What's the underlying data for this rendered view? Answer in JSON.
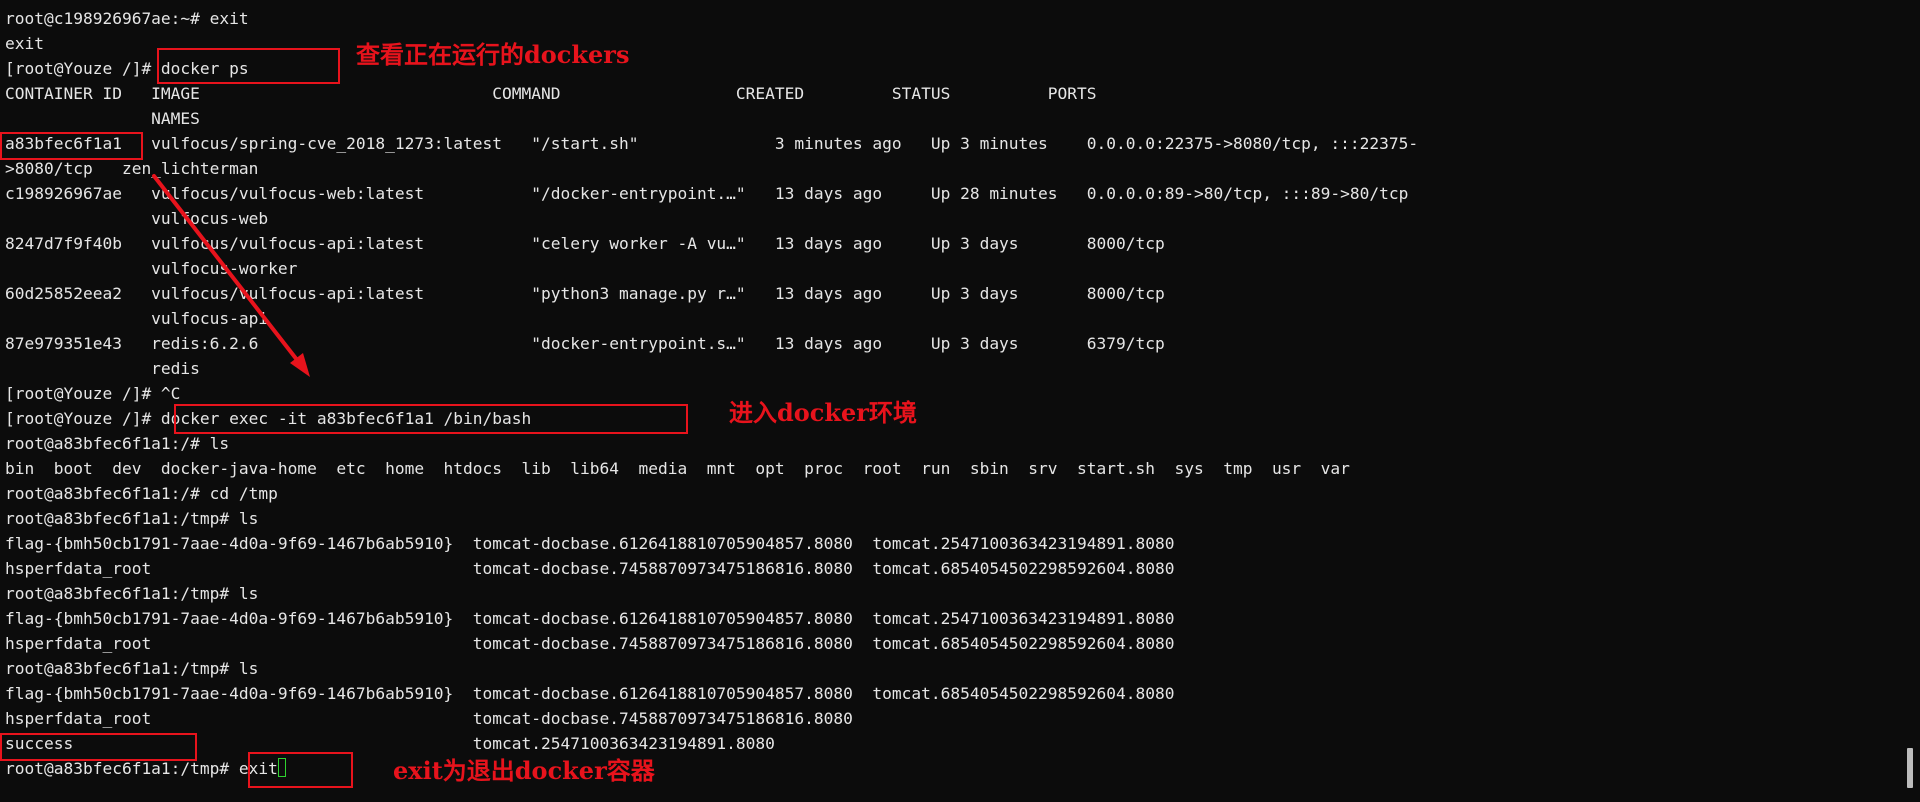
{
  "terminal": {
    "lines": [
      "root@c198926967ae:~# exit",
      "exit",
      "[root@Youze /]# docker ps",
      "CONTAINER ID   IMAGE                              COMMAND                  CREATED         STATUS          PORTS",
      "               NAMES",
      "a83bfec6f1a1   vulfocus/spring-cve_2018_1273:latest   \"/start.sh\"              3 minutes ago   Up 3 minutes    0.0.0.0:22375->8080/tcp, :::22375-",
      ">8080/tcp   zen_lichterman",
      "c198926967ae   vulfocus/vulfocus-web:latest           \"/docker-entrypoint.…\"   13 days ago     Up 28 minutes   0.0.0.0:89->80/tcp, :::89->80/tcp",
      "               vulfocus-web",
      "8247d7f9f40b   vulfocus/vulfocus-api:latest           \"celery worker -A vu…\"   13 days ago     Up 3 days       8000/tcp",
      "               vulfocus-worker",
      "60d25852eea2   vulfocus/vulfocus-api:latest           \"python3 manage.py r…\"   13 days ago     Up 3 days       8000/tcp",
      "               vulfocus-api",
      "87e979351e43   redis:6.2.6                            \"docker-entrypoint.s…\"   13 days ago     Up 3 days       6379/tcp",
      "               redis",
      "[root@Youze /]# ^C",
      "[root@Youze /]# docker exec -it a83bfec6f1a1 /bin/bash",
      "root@a83bfec6f1a1:/# ls",
      "bin  boot  dev  docker-java-home  etc  home  htdocs  lib  lib64  media  mnt  opt  proc  root  run  sbin  srv  start.sh  sys  tmp  usr  var",
      "root@a83bfec6f1a1:/# cd /tmp",
      "root@a83bfec6f1a1:/tmp# ls",
      "flag-{bmh50cb1791-7aae-4d0a-9f69-1467b6ab5910}  tomcat-docbase.6126418810705904857.8080  tomcat.2547100363423194891.8080",
      "hsperfdata_root                                 tomcat-docbase.7458870973475186816.8080  tomcat.6854054502298592604.8080",
      "root@a83bfec6f1a1:/tmp# ls",
      "flag-{bmh50cb1791-7aae-4d0a-9f69-1467b6ab5910}  tomcat-docbase.6126418810705904857.8080  tomcat.2547100363423194891.8080",
      "hsperfdata_root                                 tomcat-docbase.7458870973475186816.8080  tomcat.6854054502298592604.8080",
      "root@a83bfec6f1a1:/tmp# ls",
      "flag-{bmh50cb1791-7aae-4d0a-9f69-1467b6ab5910}  tomcat-docbase.6126418810705904857.8080  tomcat.6854054502298592604.8080",
      "hsperfdata_root                                 tomcat-docbase.7458870973475186816.8080",
      "success                                         tomcat.2547100363423194891.8080",
      "root@a83bfec6f1a1:/tmp# exit"
    ]
  },
  "annotations": {
    "docker_ps": "查看正在运行的dockers",
    "docker_exec": "进入docker环境",
    "exit": "exit为退出docker容器"
  },
  "colors": {
    "background": "#0c0c0c",
    "text": "#e6e6e6",
    "annotation_red": "#e8131c",
    "cursor_green": "#2fd22f"
  }
}
